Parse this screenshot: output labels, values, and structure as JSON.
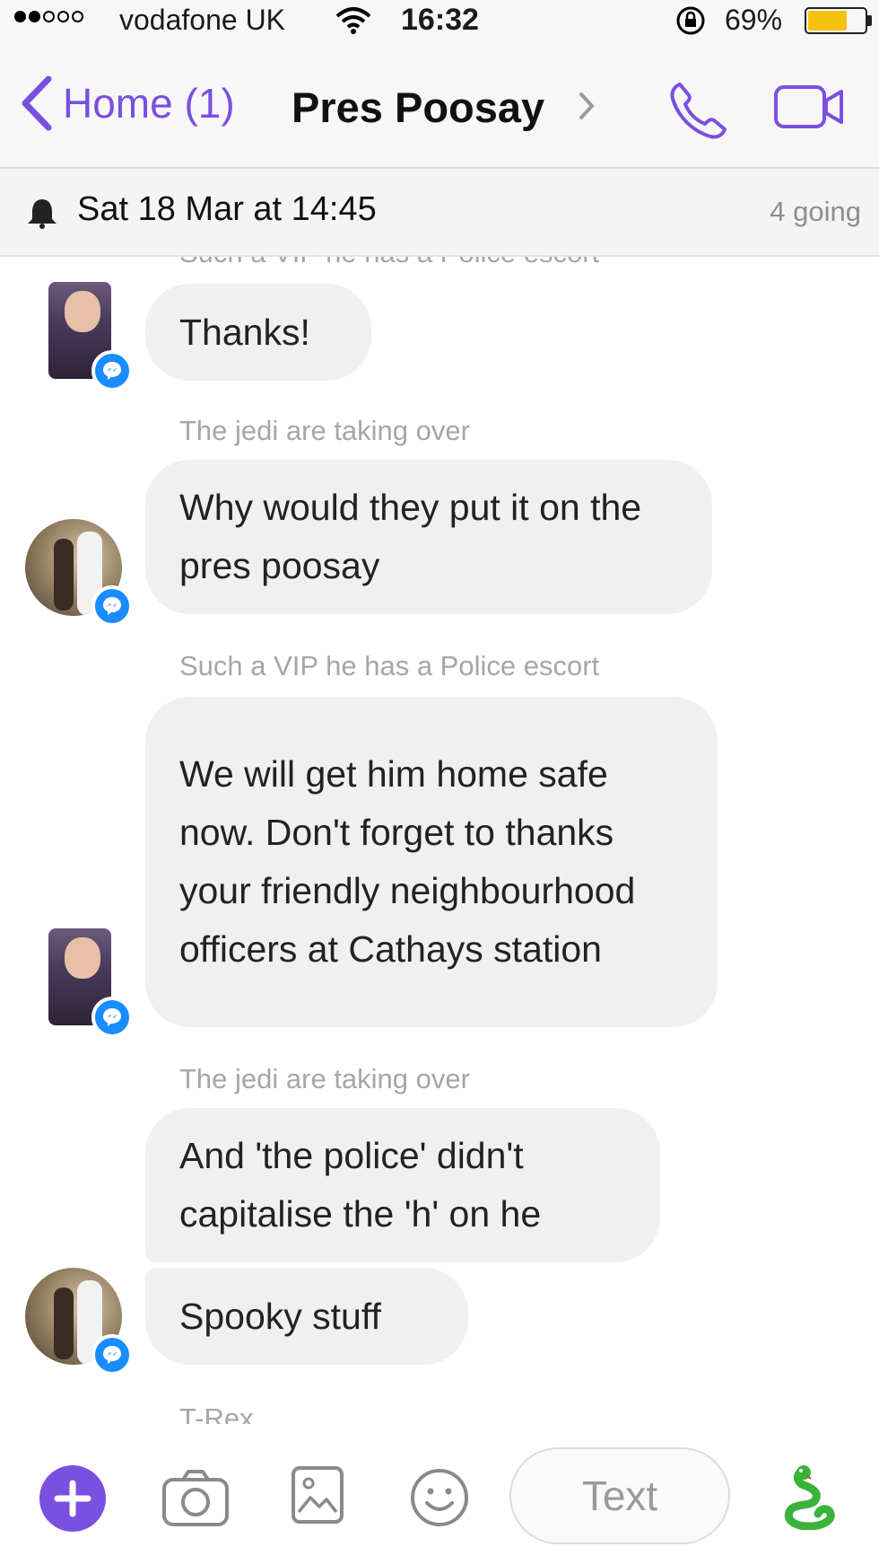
{
  "status_bar": {
    "carrier": "vodafone UK",
    "time": "16:32",
    "battery_percent": "69%",
    "battery_level": 0.69,
    "signal_bars_filled": 2,
    "signal_bars_total": 5
  },
  "nav": {
    "back_label": "Home (1)",
    "title": "Pres Poosay",
    "icons": [
      "back-chevron-icon",
      "chevron-right-icon",
      "phone-icon",
      "video-camera-icon"
    ],
    "accent_color": "#7b4fe0"
  },
  "event": {
    "date_text": "Sat 18 Mar at 14:45",
    "going_text": "4 going"
  },
  "messages": [
    {
      "sender": "Such a VIP he has a Police escort",
      "text": "Thanks!"
    },
    {
      "sender": "The jedi are taking over",
      "text": "Why would they put it on the pres poosay"
    },
    {
      "sender": "Such a VIP he has a Police escort",
      "text": "We will get him home safe now.  Don't forget to thanks your friendly neighbourhood officers at Cathays station"
    },
    {
      "sender": "The jedi are taking over",
      "text": "And 'the police' didn't capitalise the 'h' on he"
    },
    {
      "sender": "The jedi are taking over",
      "text": "Spooky stuff"
    },
    {
      "sender": "T-Rex",
      "text": ""
    }
  ],
  "composer": {
    "placeholder": "Text",
    "icons": [
      "plus-icon",
      "camera-icon",
      "image-icon",
      "emoji-icon",
      "snake-sticker-icon"
    ]
  }
}
